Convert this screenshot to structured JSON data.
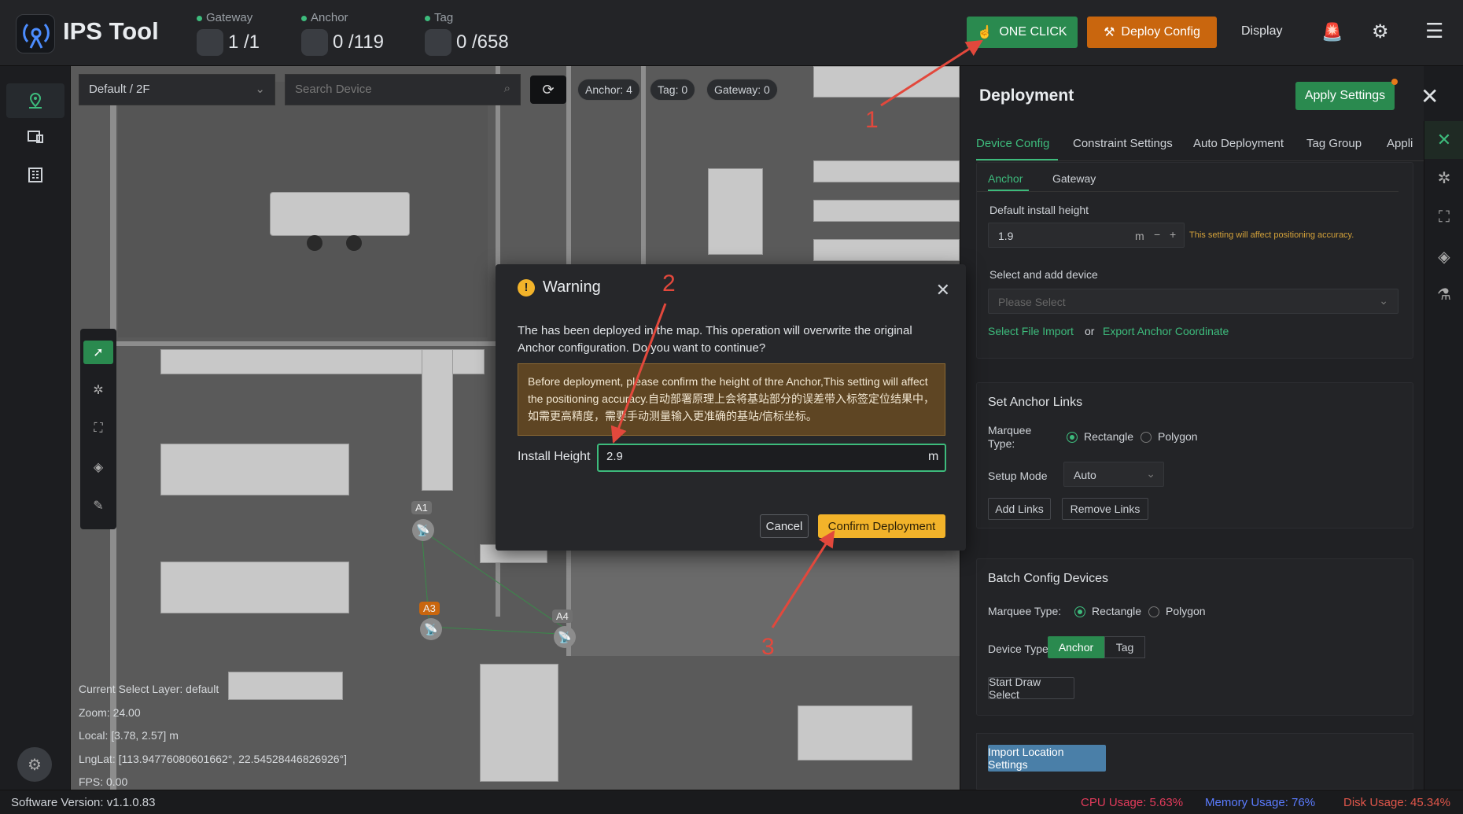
{
  "app": {
    "title": "IPS Tool"
  },
  "stats": [
    {
      "label": "Gateway",
      "value": "1 /1"
    },
    {
      "label": "Anchor",
      "value": "0 /119"
    },
    {
      "label": "Tag",
      "value": "0 /658"
    }
  ],
  "toolbar": {
    "one_click": "ONE CLICK",
    "deploy_config": "Deploy Config",
    "display": "Display"
  },
  "map": {
    "floor": "Default / 2F",
    "search_placeholder": "Search Device",
    "counts": {
      "anchor": "Anchor: 4",
      "tag": "Tag: 0",
      "gateway": "Gateway: 0"
    },
    "anchors": [
      "A1",
      "A3",
      "A4"
    ],
    "info": {
      "layer": "Current Select Layer:   default",
      "zoom": "Zoom:   24.00",
      "local": "Local:   [3.78,  2.57] m",
      "lnglat": "LngLat:   [113.94776080601662°,  22.54528446826926°]",
      "fps": "FPS:   0.00"
    }
  },
  "dialog": {
    "title": "Warning",
    "message": "The has been deployed in the map. This operation will overwrite the original Anchor configuration. Do you want to continue?",
    "note": "Before deployment, please confirm the height of thre Anchor,This setting will affect the positioning accuracy.自动部署原理上会将基站部分的误差带入标签定位结果中，如需更高精度，需要手动测量输入更准确的基站/信标坐标。",
    "field_label": "Install Height",
    "field_value": "2.9",
    "unit": "m",
    "cancel": "Cancel",
    "confirm": "Confirm Deployment"
  },
  "panel": {
    "title": "Deployment",
    "apply": "Apply Settings",
    "tabs": [
      "Device Config",
      "Constraint Settings",
      "Auto Deployment",
      "Tag Group",
      "Appli"
    ],
    "subtabs": [
      "Anchor",
      "Gateway"
    ],
    "install": {
      "label": "Default install height",
      "value": "1.9",
      "unit": "m",
      "hint": "This setting will affect positioning accuracy."
    },
    "select_add": {
      "label": "Select and add device",
      "placeholder": "Please Select",
      "import": "Select File Import",
      "or": "or",
      "export": "Export Anchor Coordinate"
    },
    "links": {
      "title": "Set Anchor Links",
      "marquee_label": "Marquee Type:",
      "rect": "Rectangle",
      "poly": "Polygon",
      "setup_label": "Setup Mode",
      "setup_value": "Auto",
      "add": "Add Links",
      "remove": "Remove Links"
    },
    "batch": {
      "title": "Batch Config Devices",
      "marquee_label": "Marquee Type:",
      "rect": "Rectangle",
      "poly": "Polygon",
      "device_type_label": "Device Type",
      "anchor": "Anchor",
      "tag": "Tag",
      "start": "Start Draw Select"
    },
    "import_location": "Import Location Settings"
  },
  "status": {
    "version": "Software Version:  v1.1.0.83",
    "cpu": "CPU Usage:  5.63%",
    "memory": "Memory Usage:  76%",
    "disk": "Disk Usage:  45.34%"
  },
  "annotations": [
    "1",
    "2",
    "3"
  ],
  "colors": {
    "accent": "#3dbb7c",
    "orange": "#c9660e",
    "confirm": "#f2b32a",
    "annotation": "#e2483c",
    "cpu": "#e23b5b",
    "memory": "#5b7cff"
  }
}
